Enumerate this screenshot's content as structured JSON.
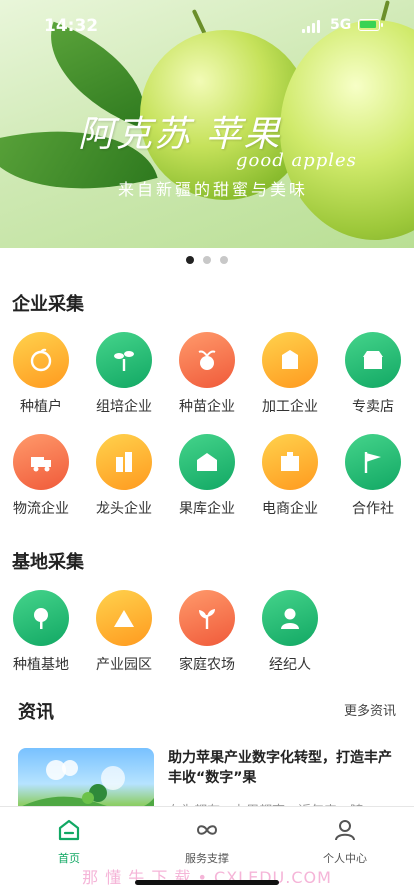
{
  "status_bar": {
    "time": "14:32",
    "network": "5G"
  },
  "banner": {
    "brand_text": "阿克苏 苹果",
    "brand_text_en": "good apples",
    "slogan": "来自新疆的甜蜜与美味",
    "slide_count": 3,
    "active_slide": 1
  },
  "enterprise": {
    "title": "企业采集",
    "items": [
      {
        "label": "种植户",
        "icon": "grower-icon",
        "color": "orange"
      },
      {
        "label": "组培企业",
        "icon": "seedling-icon",
        "color": "green"
      },
      {
        "label": "种苗企业",
        "icon": "sapling-icon",
        "color": "red"
      },
      {
        "label": "加工企业",
        "icon": "box-icon",
        "color": "orange"
      },
      {
        "label": "专卖店",
        "icon": "store-icon",
        "color": "green"
      },
      {
        "label": "物流企业",
        "icon": "truck-icon",
        "color": "red"
      },
      {
        "label": "龙头企业",
        "icon": "building-icon",
        "color": "orange"
      },
      {
        "label": "果库企业",
        "icon": "warehouse-icon",
        "color": "green"
      },
      {
        "label": "电商企业",
        "icon": "mall-icon",
        "color": "orange"
      },
      {
        "label": "合作社",
        "icon": "flag-icon",
        "color": "green"
      }
    ]
  },
  "base": {
    "title": "基地采集",
    "items": [
      {
        "label": "种植基地",
        "icon": "tree-icon",
        "color": "green"
      },
      {
        "label": "产业园区",
        "icon": "park-icon",
        "color": "orange"
      },
      {
        "label": "家庭农场",
        "icon": "farm-icon",
        "color": "red"
      },
      {
        "label": "经纪人",
        "icon": "broker-icon",
        "color": "green"
      }
    ]
  },
  "news": {
    "title": "资讯",
    "more_label": "更多资讯",
    "items": [
      {
        "title": "助力苹果产业数字化转型，打造丰产丰收“数字”果",
        "snippet": "在为都有，力用都南，近年来，随"
      }
    ]
  },
  "tabs": [
    {
      "label": "首页",
      "icon": "home-icon",
      "active": true
    },
    {
      "label": "服务支撑",
      "icon": "infinity-icon",
      "active": false
    },
    {
      "label": "个人中心",
      "icon": "user-icon",
      "active": false
    }
  ],
  "watermark": "那 懂 牛 下 载 • CXLEDU.COM",
  "colors": {
    "accent": "#12a864",
    "orange": "#ff9a1f",
    "red": "#f05a3a"
  }
}
